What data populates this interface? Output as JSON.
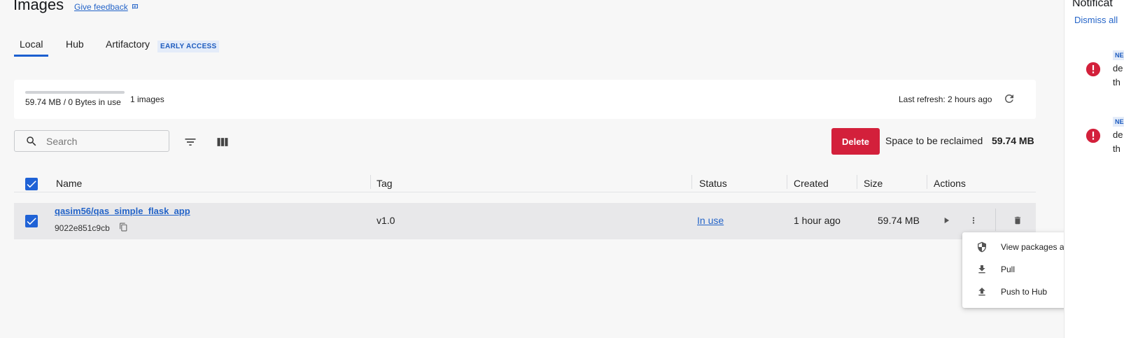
{
  "header": {
    "title": "Images",
    "feedback_label": "Give feedback"
  },
  "tabs": [
    {
      "label": "Local",
      "active": true
    },
    {
      "label": "Hub",
      "active": false
    },
    {
      "label": "Artifactory",
      "active": false,
      "badge": "EARLY ACCESS"
    }
  ],
  "usage": {
    "text": "59.74 MB / 0 Bytes in use",
    "count": "1 images",
    "last_refresh": "Last refresh: 2 hours ago"
  },
  "toolbar": {
    "search_placeholder": "Search",
    "delete_label": "Delete",
    "reclaim_label": "Space to be reclaimed",
    "reclaim_value": "59.74 MB"
  },
  "table": {
    "columns": [
      "Name",
      "Tag",
      "Status",
      "Created",
      "Size",
      "Actions"
    ],
    "rows": [
      {
        "name": "qasim56/qas_simple_flask_app",
        "id": "9022e851c9cb",
        "tag": "v1.0",
        "status": "In use",
        "created": "1 hour ago",
        "size": "59.74 MB"
      }
    ]
  },
  "menu": {
    "items": [
      {
        "label": "View packages and CVEs",
        "icon": "shield-icon"
      },
      {
        "label": "Pull",
        "icon": "download-icon"
      },
      {
        "label": "Push to Hub",
        "icon": "upload-icon"
      }
    ]
  },
  "notifications": {
    "title": "Notificat",
    "dismiss_label": "Dismiss all",
    "items": [
      {
        "badge": "NE",
        "line1": "de",
        "line2": "th"
      },
      {
        "badge": "NE",
        "line1": "de",
        "line2": "th"
      }
    ]
  },
  "colors": {
    "accent": "#1f62d6",
    "danger": "#d3203b",
    "link": "#2464c8"
  }
}
